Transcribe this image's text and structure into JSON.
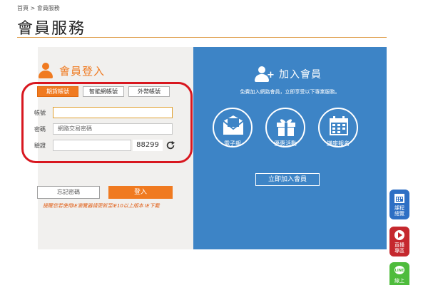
{
  "breadcrumb": {
    "home": "首頁",
    "separator": " > ",
    "current": "會員服務"
  },
  "page": {
    "title": "會員服務"
  },
  "login": {
    "title": "會員登入",
    "tabs": [
      {
        "label": "期貨帳號",
        "active": true
      },
      {
        "label": "智能網帳號",
        "active": false
      },
      {
        "label": "外幣帳號",
        "active": false
      }
    ],
    "account_label": "帳號",
    "account_value": "",
    "password_label": "密碼",
    "password_placeholder": "網路交易密碼",
    "captcha_label": "驗證",
    "captcha_value": "",
    "captcha_code": "88299",
    "forgot_label": "忘記密碼",
    "login_label": "登入",
    "notice": "提醒您若使用IE瀏覽器請更新至IE10以上版本 IE下載"
  },
  "join": {
    "title": "加入會員",
    "subtitle": "免費加入網路會員，立即享受以下專業服務。",
    "services": [
      {
        "label": "電子報",
        "icon": "envelope-icon"
      },
      {
        "label": "優惠活動",
        "icon": "gift-icon"
      },
      {
        "label": "講座報名",
        "icon": "calendar-icon"
      }
    ],
    "join_label": "立即加入會員"
  },
  "floating": [
    {
      "label1": "課程",
      "label2": "總覽",
      "color": "#2e6fc4",
      "icon": "calendar-icon"
    },
    {
      "label1": "直播",
      "label2": "專區",
      "color": "#c5282e",
      "icon": "play-icon"
    },
    {
      "label1": "LINE",
      "label2": "線上",
      "color": "#4ebc3c",
      "icon": "line-icon"
    }
  ],
  "colors": {
    "accent": "#f07a20",
    "join_blue": "#3d84c6",
    "highlight_ring": "#d8171f"
  }
}
